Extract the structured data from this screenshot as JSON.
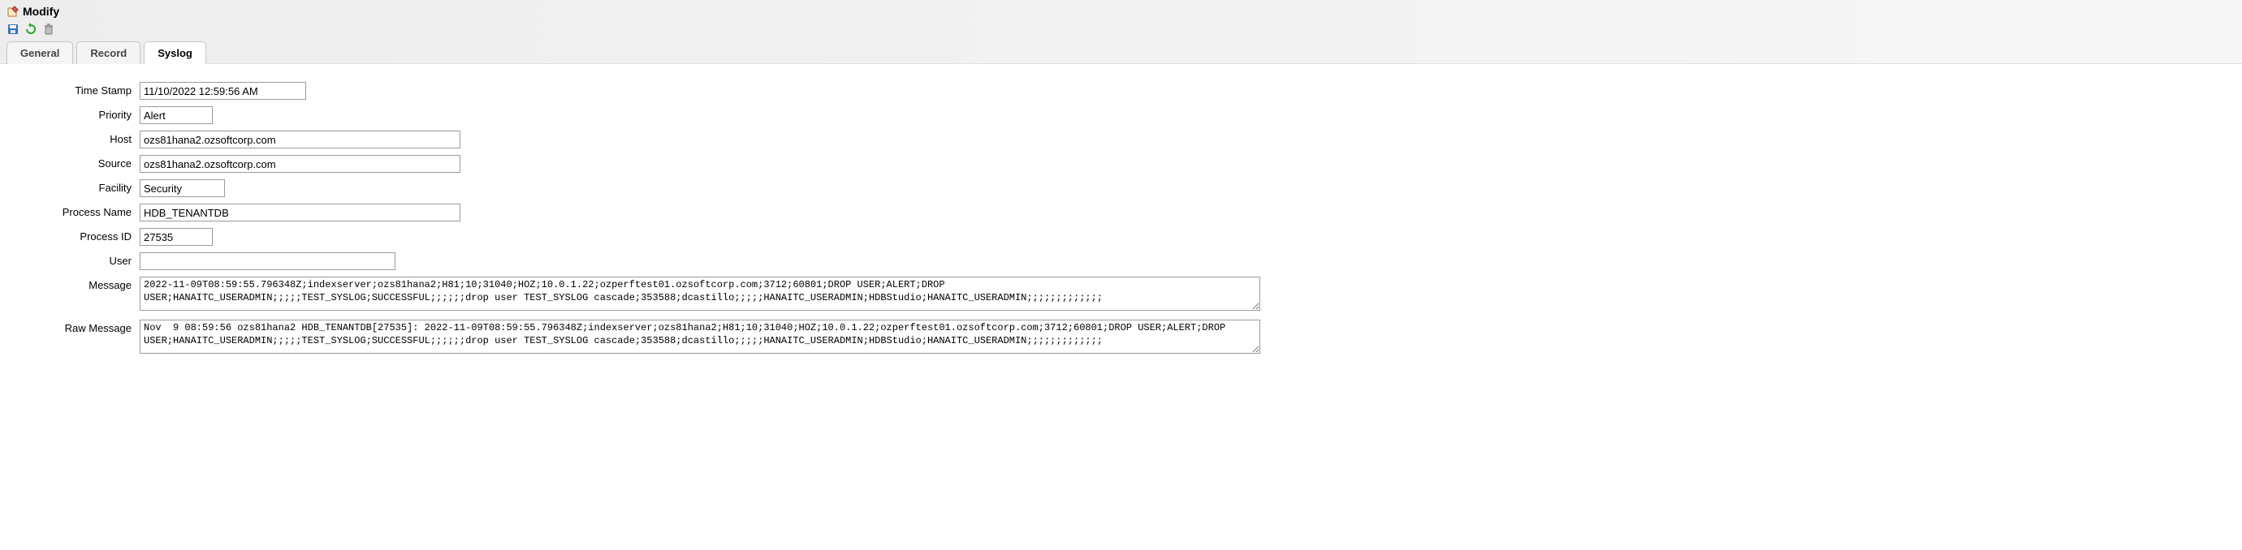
{
  "header": {
    "title": "Modify"
  },
  "tabs": [
    {
      "label": "General"
    },
    {
      "label": "Record"
    },
    {
      "label": "Syslog"
    }
  ],
  "form": {
    "time_stamp": {
      "label": "Time Stamp",
      "value": "11/10/2022 12:59:56 AM"
    },
    "priority": {
      "label": "Priority",
      "value": "Alert"
    },
    "host": {
      "label": "Host",
      "value": "ozs81hana2.ozsoftcorp.com"
    },
    "source": {
      "label": "Source",
      "value": "ozs81hana2.ozsoftcorp.com"
    },
    "facility": {
      "label": "Facility",
      "value": "Security"
    },
    "process_name": {
      "label": "Process Name",
      "value": "HDB_TENANTDB"
    },
    "process_id": {
      "label": "Process ID",
      "value": "27535"
    },
    "user": {
      "label": "User",
      "value": ""
    },
    "message": {
      "label": "Message",
      "value": "2022-11-09T08:59:55.796348Z;indexserver;ozs81hana2;H81;10;31040;HOZ;10.0.1.22;ozperftest01.ozsoftcorp.com;3712;60801;DROP USER;ALERT;DROP USER;HANAITC_USERADMIN;;;;;TEST_SYSLOG;SUCCESSFUL;;;;;;drop user TEST_SYSLOG cascade;353588;dcastillo;;;;;HANAITC_USERADMIN;HDBStudio;HANAITC_USERADMIN;;;;;;;;;;;;;"
    },
    "raw_message": {
      "label": "Raw Message",
      "value": "Nov  9 08:59:56 ozs81hana2 HDB_TENANTDB[27535]: 2022-11-09T08:59:55.796348Z;indexserver;ozs81hana2;H81;10;31040;HOZ;10.0.1.22;ozperftest01.ozsoftcorp.com;3712;60801;DROP USER;ALERT;DROP USER;HANAITC_USERADMIN;;;;;TEST_SYSLOG;SUCCESSFUL;;;;;;drop user TEST_SYSLOG cascade;353588;dcastillo;;;;;HANAITC_USERADMIN;HDBStudio;HANAITC_USERADMIN;;;;;;;;;;;;;"
    }
  }
}
